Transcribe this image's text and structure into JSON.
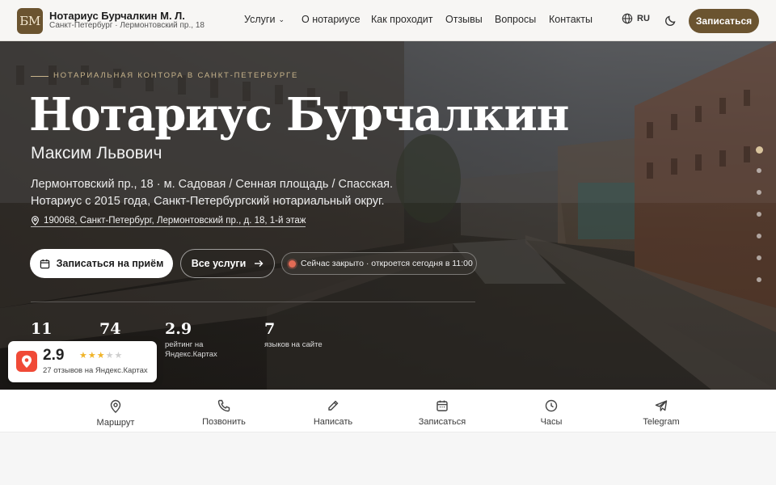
{
  "header": {
    "logo_text": "БМ",
    "title": "Нотариус Бурчалкин М. Л.",
    "subtitle": "Санкт-Петербург · Лермонтовский пр., 18",
    "nav": [
      {
        "label": "Услуги",
        "has_dropdown": true
      },
      {
        "label": "О нотариусе"
      },
      {
        "label": "Как проходит"
      },
      {
        "label": "Отзывы"
      },
      {
        "label": "Вопросы"
      },
      {
        "label": "Контакты"
      }
    ],
    "lang": "RU",
    "cta": "Записаться"
  },
  "hero": {
    "eyebrow": "Нотариальная контора в Санкт-Петербурге",
    "title": "Нотариус Бурчалкин",
    "subtitle": "Максим Львович",
    "desc_line1": "Лермонтовский пр., 18 · м. Садовая / Сенная площадь / Спасская.",
    "desc_line2": "Нотариус с 2015 года, Санкт-Петербургский нотариальный округ.",
    "address": "190068, Санкт-Петербург, Лермонтовский пр., д. 18, 1-й этаж",
    "btn_primary": "Записаться на приём",
    "btn_secondary": "Все услуги",
    "status": "Сейчас закрыто · откроется сегодня в 11:00",
    "stats": [
      {
        "value": "11",
        "label": ""
      },
      {
        "value": "74",
        "label": ""
      },
      {
        "value": "2.9",
        "label": "рейтинг на Яндекс.Картах"
      },
      {
        "value": "7",
        "label": "языков на сайте"
      }
    ],
    "slides": {
      "count": 7,
      "active": 1
    }
  },
  "yandex": {
    "score": "2.9",
    "rating": 2.9,
    "stars_max": 5,
    "reviews": "27 отзывов на Яндекс.Картах"
  },
  "actions": [
    {
      "label": "Маршрут",
      "icon": "map-pin-icon"
    },
    {
      "label": "Позвонить",
      "icon": "phone-icon"
    },
    {
      "label": "Написать",
      "icon": "pencil-icon"
    },
    {
      "label": "Записаться",
      "icon": "calendar-icon"
    },
    {
      "label": "Часы",
      "icon": "clock-icon"
    },
    {
      "label": "Telegram",
      "icon": "telegram-icon"
    }
  ],
  "colors": {
    "brand": "#6b5430",
    "accent_gold": "#c8b48b",
    "status_closed": "#e36b55",
    "yandex_red": "#f04a37",
    "star": "#f0b429"
  }
}
